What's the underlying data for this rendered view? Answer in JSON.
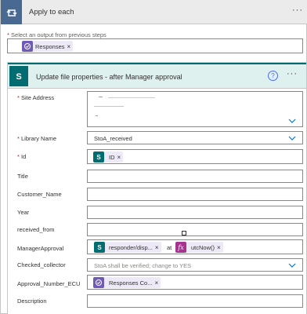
{
  "loop": {
    "title": "Apply to each",
    "more_icon": "more-horizontal-icon",
    "select_label": "Select an output from previous steps",
    "select_required": "*",
    "selected_token": {
      "label": "Responses",
      "remove": "×",
      "icon": "forms-icon"
    }
  },
  "action": {
    "title": "Update file properties - after Manager approval",
    "help": "?",
    "more": "···",
    "colors": {
      "accent": "#036c70",
      "header_bg": "#dff1ef",
      "token_bg": "#ede9f7",
      "forms": "#6f5ab8",
      "expr": "#a4348f"
    }
  },
  "fields": {
    "site_address": {
      "label": "Site Address",
      "required": "*"
    },
    "library_name": {
      "label": "Library Name",
      "required": "*",
      "value": "StoA_received"
    },
    "id": {
      "label": "Id",
      "required": "*",
      "token": "ID",
      "remove": "×"
    },
    "title": {
      "label": "Title"
    },
    "customer_name": {
      "label": "Customer_Name"
    },
    "year": {
      "label": "Year"
    },
    "received_from": {
      "label": "received_from"
    },
    "manager_approval": {
      "label": "ManagerApproval",
      "token1": "responder/disp...",
      "remove": "×",
      "at": "at",
      "token2": "utcNow()"
    },
    "checked_collector": {
      "label": "Checked_collector",
      "placeholder": "StoA shall be verified; change to YES"
    },
    "approval_number": {
      "label": "Approval_Number_ECU",
      "token": "Responses Co...",
      "remove": "×"
    },
    "description": {
      "label": "Description"
    }
  }
}
